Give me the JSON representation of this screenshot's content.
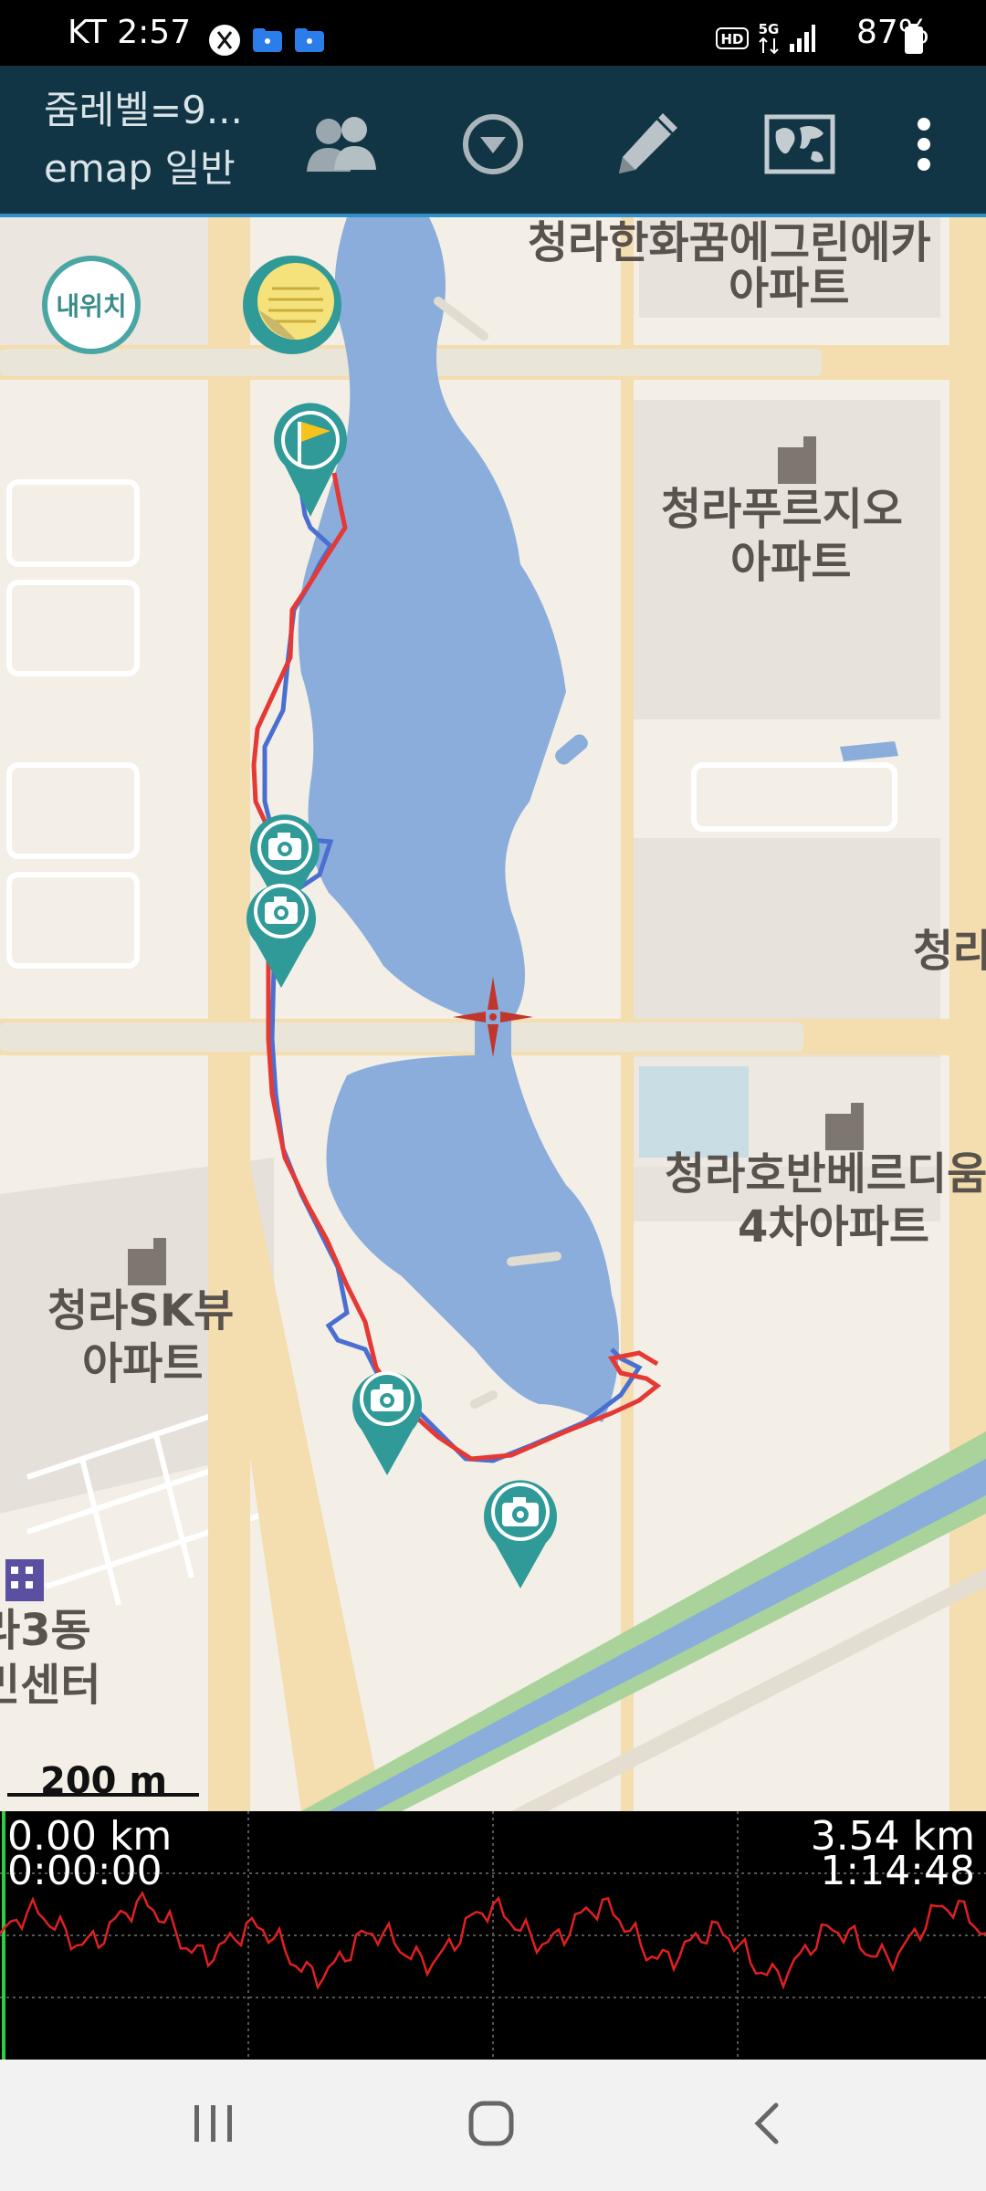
{
  "status_bar": {
    "carrier": "KT",
    "time": "2:57",
    "network": "5G",
    "battery": "87%",
    "icons": [
      "x-app-icon",
      "folder-icon",
      "folder-icon",
      "hd-voice-icon",
      "5g-data-icon",
      "signal-icon",
      "battery-icon"
    ]
  },
  "toolbar": {
    "title_line1": "줌레벨=9...",
    "title_line2": "emap 일반",
    "buttons": [
      "group-icon",
      "dropdown-icon",
      "pencil-icon",
      "map-layers-icon",
      "more-vert-icon"
    ],
    "background": "#113544"
  },
  "map": {
    "my_location_label": "내위치",
    "labels": [
      {
        "text": "청라한화꿈에그린에카",
        "name": "label-hanwha"
      },
      {
        "text": "아파트",
        "name": "label-hanwha-apt"
      },
      {
        "text": "청라푸르지오",
        "name": "label-prugio"
      },
      {
        "text": "아파트",
        "name": "label-prugio-apt"
      },
      {
        "text": "청라",
        "name": "label-cheongna"
      },
      {
        "text": "청라호반베르디움",
        "name": "label-hoban"
      },
      {
        "text": "4차아파트",
        "name": "label-hoban-apt"
      },
      {
        "text": "청라SK뷰",
        "name": "label-sk"
      },
      {
        "text": "아파트",
        "name": "label-sk-apt"
      },
      {
        "text": "라3동",
        "name": "label-dong"
      },
      {
        "text": "민센터",
        "name": "label-center"
      }
    ],
    "markers": [
      "start-flag-marker",
      "photo-marker",
      "photo-marker",
      "photo-marker",
      "photo-marker"
    ],
    "track_colors": {
      "recorded": "#e53935",
      "planned": "#4a6fd1"
    },
    "water_color": "#8aaddc",
    "scale_label": "200 m"
  },
  "elevation": {
    "start_distance": "0.00 km",
    "start_time": "0:00:00",
    "end_distance": "3.54 km",
    "end_time": "1:14:48",
    "line_color": "#e02020"
  },
  "nav_bar": {
    "buttons": [
      "recents-icon",
      "home-icon",
      "back-icon"
    ]
  }
}
